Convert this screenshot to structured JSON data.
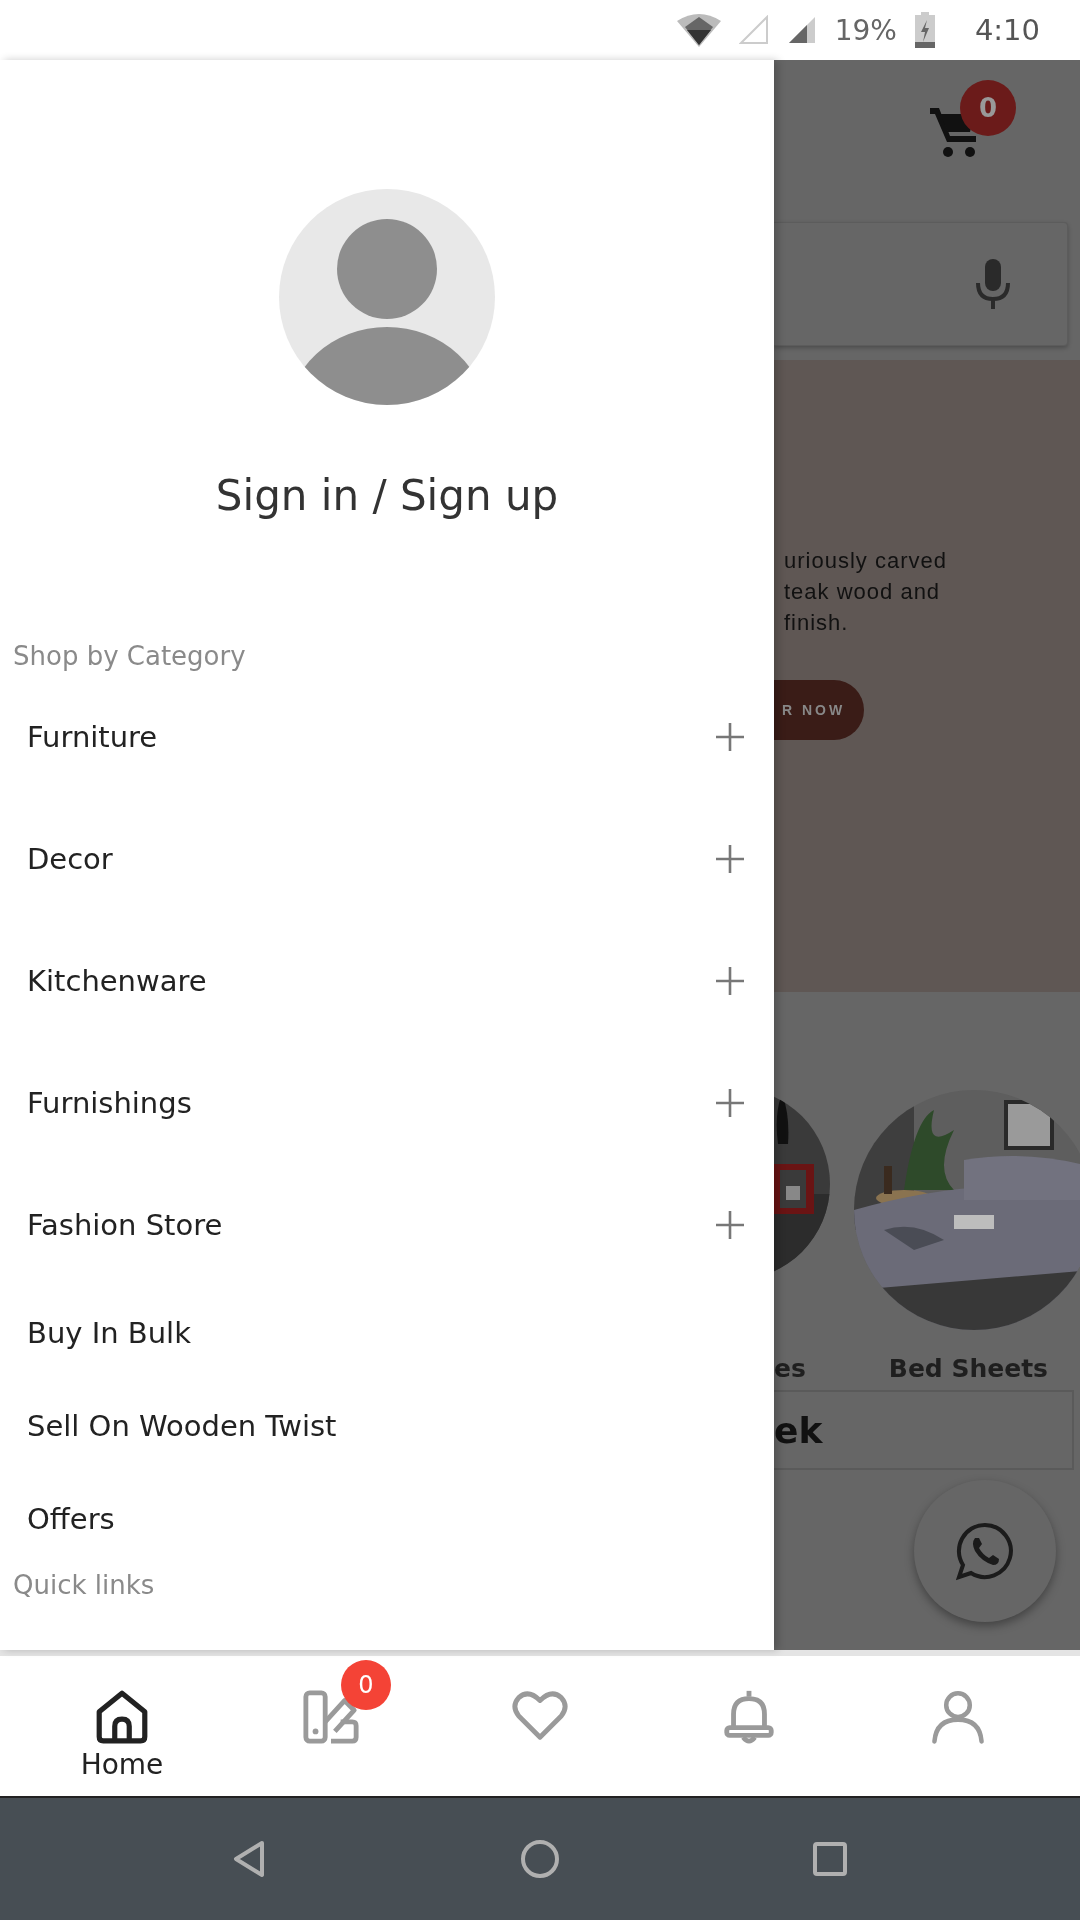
{
  "status_bar": {
    "battery": "19%",
    "time": "4:10"
  },
  "background_page": {
    "cart_count": "0",
    "banner_lines": [
      "uriously carved",
      "teak wood and",
      "finish."
    ],
    "banner_button": "R NOW",
    "categories": [
      {
        "label": "es"
      },
      {
        "label": "Bed Sheets"
      }
    ],
    "section_title": "ek"
  },
  "drawer": {
    "sign_in": "Sign in / Sign up",
    "section_title": "Shop by Category",
    "items": [
      {
        "label": "Furniture",
        "expandable": true
      },
      {
        "label": "Decor",
        "expandable": true
      },
      {
        "label": "Kitchenware",
        "expandable": true
      },
      {
        "label": "Furnishings",
        "expandable": true
      },
      {
        "label": "Fashion Store",
        "expandable": true
      },
      {
        "label": "Buy In Bulk",
        "expandable": false
      },
      {
        "label": "Sell On Wooden Twist",
        "expandable": false
      },
      {
        "label": "Offers",
        "expandable": false
      }
    ],
    "quick_links": "Quick links"
  },
  "bottom_nav": [
    {
      "kind": "home",
      "label": "Home",
      "selected": true
    },
    {
      "kind": "catalog",
      "badge": "0",
      "selected": false
    },
    {
      "kind": "wishlist",
      "selected": false
    },
    {
      "kind": "notifications",
      "selected": false
    },
    {
      "kind": "account",
      "selected": false
    }
  ]
}
